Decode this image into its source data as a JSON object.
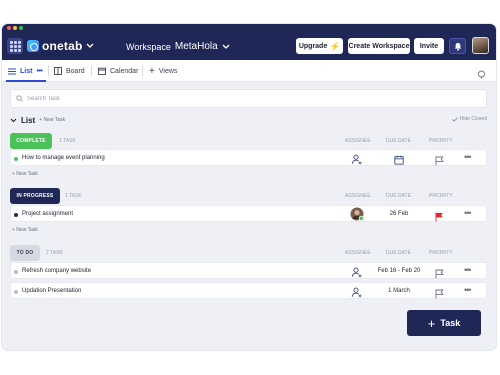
{
  "header": {
    "logo_text": "onetab",
    "workspace_label": "Workspace",
    "workspace_name": "MetaHola",
    "upgrade_label": "Upgrade",
    "create_workspace_label": "Create Workspace",
    "invite_label": "Invite"
  },
  "tabs": {
    "list": "List",
    "board": "Board",
    "calendar": "Calendar",
    "views": "Views"
  },
  "search": {
    "placeholder": "Search Task"
  },
  "list": {
    "title": "List",
    "new_task": "+ New Task",
    "hide_closed": "Hide Closed"
  },
  "columns": {
    "assignee": "ASSIGNEE",
    "due_date": "DUE DATE",
    "priority": "PRIORITY"
  },
  "groups": [
    {
      "status": "COMPLETE",
      "count": "1 TASK",
      "color": "#4cc35a",
      "add_label": "+ New Task",
      "tasks": [
        {
          "name": "How to manage event planning",
          "due": "",
          "dot": "#4cc35a",
          "priority_color": "#6b7184",
          "assignee": "add-user-icon"
        }
      ]
    },
    {
      "status": "IN PROGRESS",
      "count": "1 TASK",
      "color": "#1f2757",
      "add_label": "+ New Task",
      "tasks": [
        {
          "name": "Project assignment",
          "due": "26 Feb",
          "dot": "#1f2757",
          "priority_color": "#e5262e",
          "assignee": "avatar"
        }
      ]
    },
    {
      "status": "TO DO",
      "count": "2 TASK",
      "color": "#d6d9e2",
      "add_label": "",
      "tasks": [
        {
          "name": "Refresh company website",
          "due": "Feb 16 - Feb 20",
          "dot": "#b9bdc9",
          "priority_color": "#6b7184",
          "assignee": "add-user-icon"
        },
        {
          "name": "Updation Presentation",
          "due": "1 March",
          "dot": "#b9bdc9",
          "priority_color": "#6b7184",
          "assignee": "add-user-icon"
        }
      ]
    }
  ],
  "task_button": {
    "label": "Task"
  },
  "colors": {
    "navy": "#1f2757",
    "accent": "#2e48d9",
    "complete": "#4cc35a",
    "urgent": "#e5262e"
  }
}
